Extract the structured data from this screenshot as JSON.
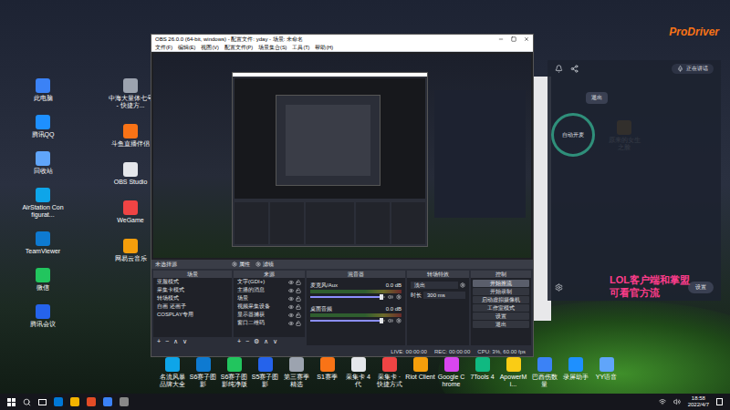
{
  "desktop": {
    "left_icons": [
      {
        "label": "此电脑"
      },
      {
        "label": "腾讯QQ"
      },
      {
        "label": "回收站"
      },
      {
        "label": "AirStation Configurat..."
      },
      {
        "label": "TeamViewer"
      },
      {
        "label": "微信"
      },
      {
        "label": "腾讯会议"
      }
    ],
    "left_icons_2": [
      {
        "label": "中海大量体七号 - 快捷方..."
      },
      {
        "label": "斗鱼直播伴侣"
      },
      {
        "label": "OBS Studio"
      },
      {
        "label": "WeGame"
      },
      {
        "label": "网易云音乐"
      }
    ],
    "bottom_icons": [
      {
        "label": "名流风暴品牌大全"
      },
      {
        "label": "S6赛子图影"
      },
      {
        "label": "S6赛子图影纯净版"
      },
      {
        "label": "S5赛子图影"
      },
      {
        "label": "第三赛季精选"
      },
      {
        "label": "S1赛季"
      },
      {
        "label": "采集卡 4代"
      },
      {
        "label": "采集卡 · 快捷方式"
      },
      {
        "label": "Riot Client"
      },
      {
        "label": "Google Chrome"
      },
      {
        "label": "7Tools 4"
      },
      {
        "label": "ApowerMi..."
      },
      {
        "label": "巴西伤数量"
      },
      {
        "label": "录屏助手"
      },
      {
        "label": "YY语音"
      }
    ],
    "right_icon": {
      "label": "原来的女生之脸"
    },
    "overlay_text": [
      "LOL客户端和掌盟",
      "可看官方流"
    ]
  },
  "obs": {
    "title": "OBS 26.0.0 (64-bit, windows) - 配置文件: yday - 场景: 未命名",
    "menu": [
      "文件(F)",
      "编辑(E)",
      "视图(V)",
      "配置文件(P)",
      "场景集合(S)",
      "工具(T)",
      "帮助(H)"
    ],
    "source_bar": {
      "label": "未选择源",
      "buttons": [
        "属性",
        "滤镜"
      ]
    },
    "scenes": {
      "title": "场景",
      "items": [
        {
          "label": "亚服模式",
          "selected": false
        },
        {
          "label": "采集卡模式",
          "selected": false
        },
        {
          "label": "转场模式",
          "selected": false
        },
        {
          "label": "自画 还画子",
          "selected": false
        },
        {
          "label": "COSPLAY专用",
          "selected": false
        }
      ],
      "toolbar": [
        "+",
        "−",
        "∧",
        "∨"
      ]
    },
    "sources": {
      "title": "来源",
      "items": [
        {
          "label": "文字(GDI+)",
          "visible": true,
          "locked": false
        },
        {
          "label": "主播的消息",
          "visible": true,
          "locked": false
        },
        {
          "label": "场景",
          "visible": true,
          "locked": false
        },
        {
          "label": "视频采集设备",
          "visible": true,
          "locked": false
        },
        {
          "label": "显示器捕获",
          "visible": true,
          "locked": false
        },
        {
          "label": "窗口二维码",
          "visible": true,
          "locked": false
        }
      ],
      "toolbar": [
        "+",
        "−",
        "⚙",
        "∧",
        "∨"
      ]
    },
    "mixer": {
      "title": "混音器",
      "channels": [
        {
          "name": "麦克风/Aux",
          "reading": "0.0 dB",
          "level": 0.0,
          "volume": 0.95,
          "muted": false
        },
        {
          "name": "桌面音频",
          "reading": "0.0 dB",
          "level": 0.0,
          "volume": 0.95,
          "muted": false
        }
      ]
    },
    "transitions": {
      "title": "转场特效",
      "type": "淡出",
      "duration_label": "时长",
      "duration": "300 ms"
    },
    "controls": {
      "title": "控制",
      "buttons": [
        {
          "label": "开始推流",
          "selected": true
        },
        {
          "label": "开始录制",
          "selected": false
        },
        {
          "label": "启动虚拟摄像机",
          "selected": false
        },
        {
          "label": "工作室模式",
          "selected": false
        },
        {
          "label": "设置",
          "selected": false
        },
        {
          "label": "退出",
          "selected": false
        }
      ]
    },
    "status": [
      "LIVE: 00:00:00",
      "REC: 00:00:00",
      "CPU: 3%, 60.00 fps"
    ]
  },
  "prodriver": {
    "logo": "ProDriver",
    "speaking": "正在讲话",
    "exit": "退出",
    "mic": "自动开麦",
    "settings": "设置"
  },
  "taskbar": {
    "time": "18:58",
    "date": "2022/4/7"
  }
}
